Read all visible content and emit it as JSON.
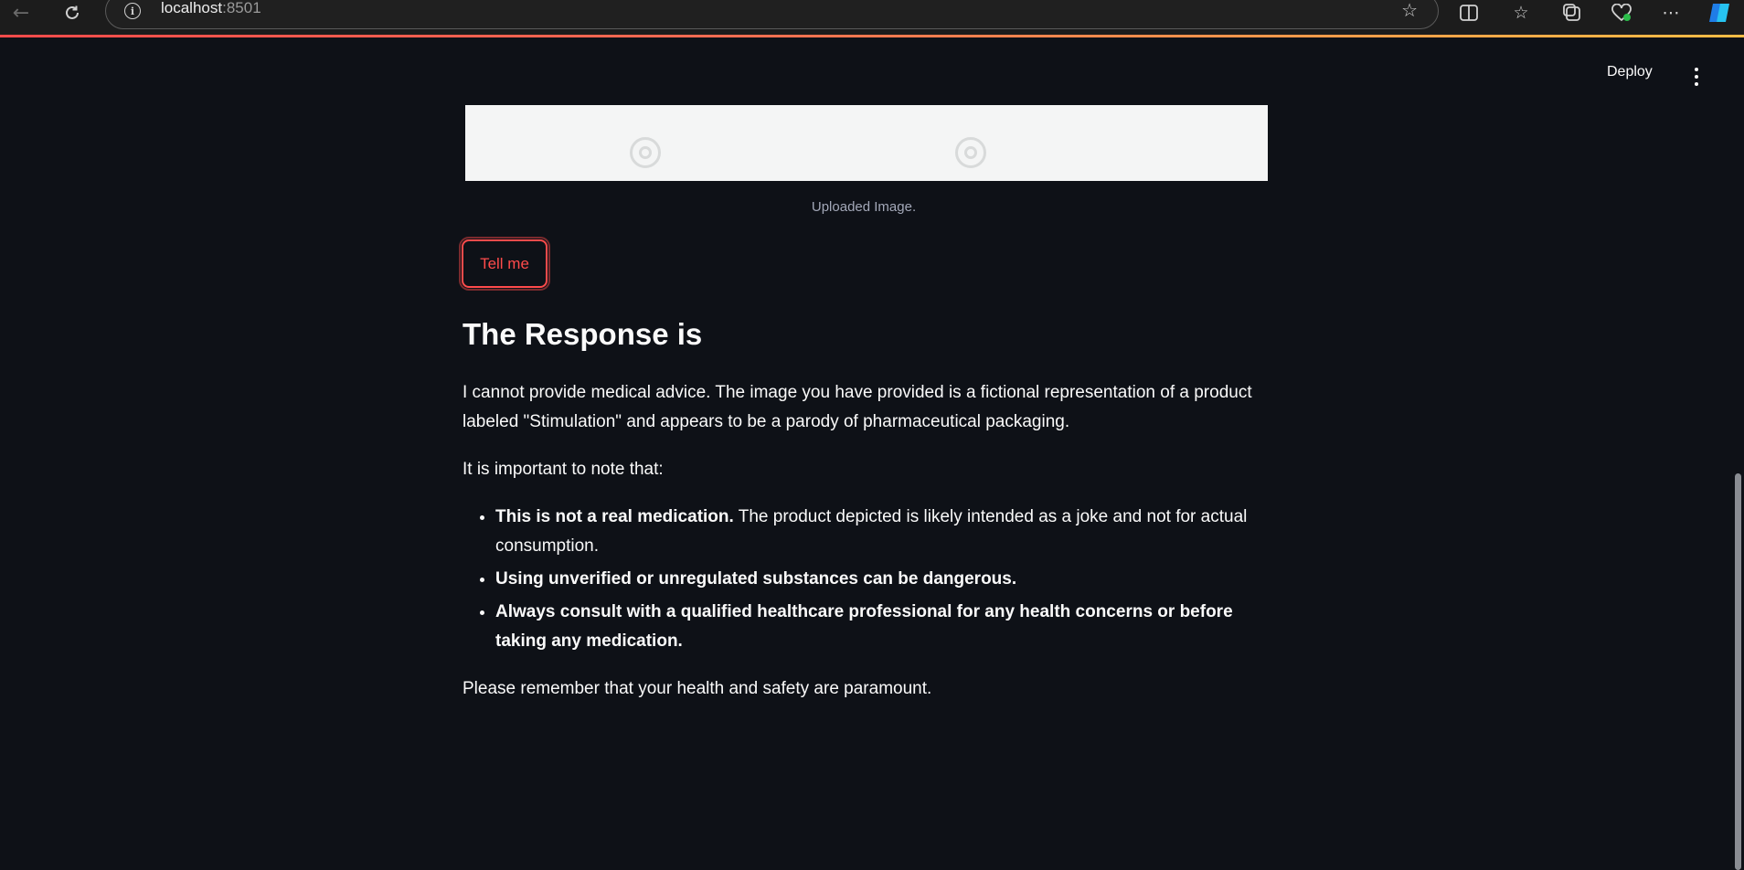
{
  "browser": {
    "back_icon": "back-arrow-icon",
    "reload_icon": "reload-icon",
    "address": {
      "info_icon": "info-icon",
      "host": "localhost",
      "port": ":8501",
      "favorite_icon": "star-icon"
    },
    "toolbar_icons": [
      "split-screen-icon",
      "favorites-icon",
      "collections-icon",
      "browser-essentials-icon",
      "more-icon",
      "copilot-icon"
    ],
    "loading_bar_colors": [
      "#ff4b4b",
      "#ffbd45"
    ]
  },
  "header": {
    "deploy_label": "Deploy",
    "menu_icon": "vertical-dots-icon"
  },
  "main": {
    "image_caption": "Uploaded Image.",
    "tell_me_label": "Tell me",
    "heading": "The Response is",
    "paragraph_1": "I cannot provide medical advice. The image you have provided is a fictional representation of a product labeled \"Stimulation\" and appears to be a parody of pharmaceutical packaging.",
    "paragraph_2": "It is important to note that:",
    "bullets": [
      {
        "bold": "This is not a real medication.",
        "text": " The product depicted is likely intended as a joke and not for actual consumption."
      },
      {
        "bold": "Using unverified or unregulated substances can be dangerous.",
        "text": ""
      },
      {
        "bold": "Always consult with a qualified healthcare professional for any health concerns or before taking any medication.",
        "text": ""
      }
    ],
    "paragraph_3": "Please remember that your health and safety are paramount."
  },
  "colors": {
    "background": "#0e1117",
    "primary": "#ff4b4b",
    "text": "#fafafa",
    "caption": "#a3a8b8"
  }
}
